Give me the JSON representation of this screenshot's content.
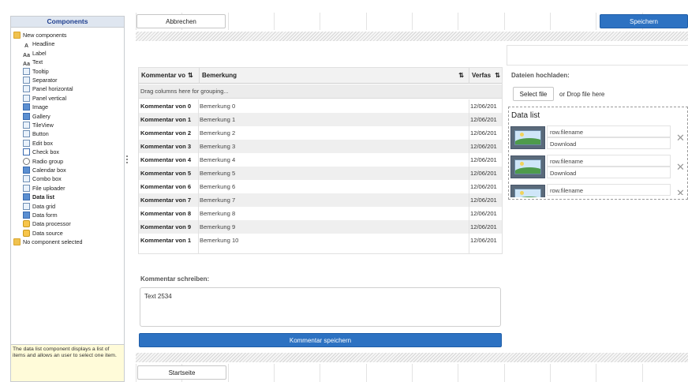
{
  "left_panel": {
    "title": "Components",
    "items": [
      {
        "label": "New components",
        "icon": "folder-icon"
      },
      {
        "label": "Headline",
        "icon": "headline-icon"
      },
      {
        "label": "Label",
        "icon": "label-icon"
      },
      {
        "label": "Text",
        "icon": "text-icon"
      },
      {
        "label": "Tooltip",
        "icon": "tooltip-icon"
      },
      {
        "label": "Separator",
        "icon": "separator-icon"
      },
      {
        "label": "Panel horizontal",
        "icon": "panel-horizontal-icon"
      },
      {
        "label": "Panel vertical",
        "icon": "panel-vertical-icon"
      },
      {
        "label": "Image",
        "icon": "image-icon"
      },
      {
        "label": "Gallery",
        "icon": "gallery-icon"
      },
      {
        "label": "TileView",
        "icon": "tileview-icon"
      },
      {
        "label": "Button",
        "icon": "button-icon"
      },
      {
        "label": "Edit box",
        "icon": "edit-box-icon"
      },
      {
        "label": "Check box",
        "icon": "check-box-icon"
      },
      {
        "label": "Radio group",
        "icon": "radio-group-icon"
      },
      {
        "label": "Calendar box",
        "icon": "calendar-icon"
      },
      {
        "label": "Combo box",
        "icon": "combo-box-icon"
      },
      {
        "label": "File uploader",
        "icon": "file-uploader-icon"
      },
      {
        "label": "Data list",
        "icon": "data-list-icon"
      },
      {
        "label": "Data grid",
        "icon": "data-grid-icon"
      },
      {
        "label": "Data form",
        "icon": "data-form-icon"
      },
      {
        "label": "Data processor",
        "icon": "data-processor-icon"
      },
      {
        "label": "Data source",
        "icon": "data-source-icon"
      },
      {
        "label": "No component selected",
        "icon": "folder-icon"
      }
    ],
    "description": "The data list component displays a list of items and allows an user to select one item."
  },
  "toolbar": {
    "cancel_label": "Abbrechen",
    "save_label": "Speichern"
  },
  "grid": {
    "columns": [
      "Kommentar vo",
      "Bemerkung",
      "Verfas"
    ],
    "group_hint": "Drag columns here for grouping...",
    "rows": [
      [
        "Kommentar von 0",
        "Bemerkung 0",
        "12/06/201"
      ],
      [
        "Kommentar von 1",
        "Bemerkung 1",
        "12/06/201"
      ],
      [
        "Kommentar von 2",
        "Bemerkung 2",
        "12/06/201"
      ],
      [
        "Kommentar von 3",
        "Bemerkung 3",
        "12/06/201"
      ],
      [
        "Kommentar von 4",
        "Bemerkung 4",
        "12/06/201"
      ],
      [
        "Kommentar von 5",
        "Bemerkung 5",
        "12/06/201"
      ],
      [
        "Kommentar von 6",
        "Bemerkung 6",
        "12/06/201"
      ],
      [
        "Kommentar von 7",
        "Bemerkung 7",
        "12/06/201"
      ],
      [
        "Kommentar von 8",
        "Bemerkung 8",
        "12/06/201"
      ],
      [
        "Kommentar von 9",
        "Bemerkung 9",
        "12/06/201"
      ],
      [
        "Kommentar von 1",
        "Bemerkung 10",
        "12/06/201"
      ]
    ]
  },
  "comment": {
    "label": "Kommentar schreiben:",
    "value": "Text 2534",
    "submit_label": "Kommentar speichern"
  },
  "upload": {
    "title": "Dateien hochladen:",
    "select_label": "Select file",
    "drop_hint": "or Drop file here"
  },
  "data_list": {
    "title": "Data list",
    "items": [
      {
        "filename": "row.filename",
        "action": "Download"
      },
      {
        "filename": "row.filename",
        "action": "Download"
      },
      {
        "filename": "row.filename",
        "action": ""
      }
    ]
  },
  "footer": {
    "home_label": "Startseite"
  },
  "colors": {
    "accent": "#2d72c2",
    "tooltip_bg": "#fffbd9"
  }
}
